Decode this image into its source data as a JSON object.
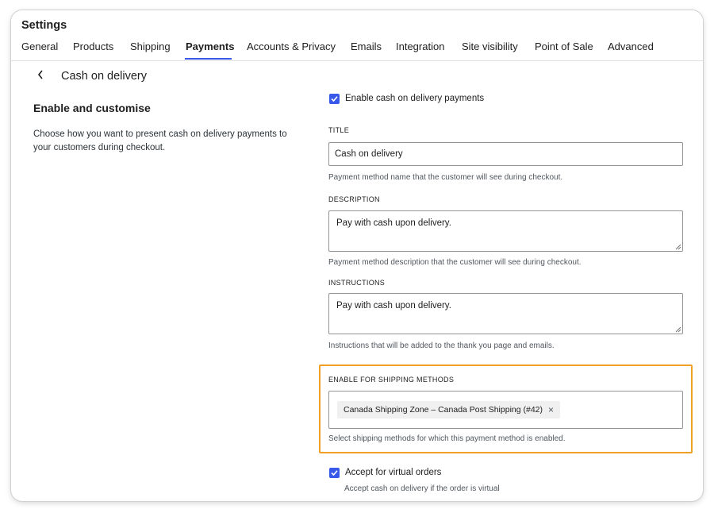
{
  "header": {
    "title": "Settings",
    "tabs": [
      {
        "label": "General"
      },
      {
        "label": "Products"
      },
      {
        "label": "Shipping"
      },
      {
        "label": "Payments"
      },
      {
        "label": "Accounts & Privacy"
      },
      {
        "label": "Emails"
      },
      {
        "label": "Integration"
      },
      {
        "label": "Site visibility"
      },
      {
        "label": "Point of Sale"
      },
      {
        "label": "Advanced"
      }
    ],
    "active_tab": "Payments"
  },
  "page": {
    "heading": "Cash on delivery"
  },
  "section": {
    "title": "Enable and customise",
    "description": "Choose how you want to present cash on delivery payments to your customers during checkout."
  },
  "form": {
    "enable": {
      "label": "Enable cash on delivery payments",
      "checked": true
    },
    "title": {
      "label": "TITLE",
      "value": "Cash on delivery",
      "help": "Payment method name that the customer will see during checkout."
    },
    "description": {
      "label": "DESCRIPTION",
      "value": "Pay with cash upon delivery.",
      "help": "Payment method description that the customer will see during checkout."
    },
    "instructions": {
      "label": "INSTRUCTIONS",
      "value": "Pay with cash upon delivery.",
      "help": "Instructions that will be added to the thank you page and emails."
    },
    "shipping_methods": {
      "label": "ENABLE FOR SHIPPING METHODS",
      "selected": [
        "Canada Shipping Zone – Canada Post Shipping (#42)"
      ],
      "remove_glyph": "×",
      "help": "Select shipping methods for which this payment method is enabled."
    },
    "virtual_orders": {
      "label": "Accept for virtual orders",
      "checked": true,
      "help": "Accept cash on delivery if the order is virtual"
    }
  },
  "colors": {
    "accent": "#3858e9",
    "highlight": "#f0a024"
  }
}
